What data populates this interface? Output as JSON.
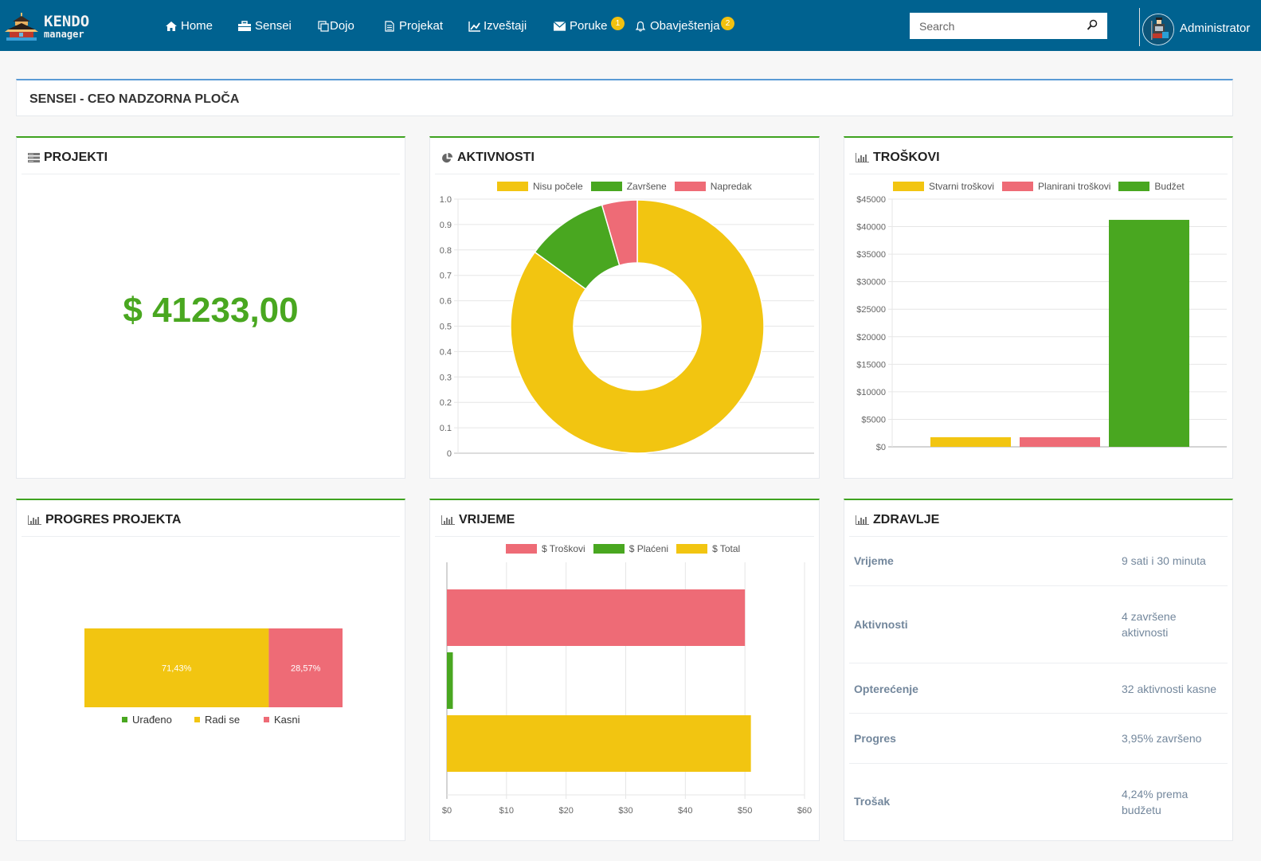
{
  "navbar": {
    "logo_line1": "KENDO",
    "logo_line2": "manager",
    "items": [
      {
        "label": "Home",
        "icon": "home-icon"
      },
      {
        "label": "Sensei",
        "icon": "briefcase-icon"
      },
      {
        "label": "Dojo",
        "icon": "copy-icon"
      },
      {
        "label": "Projekat",
        "icon": "document-icon"
      },
      {
        "label": "Izveštaji",
        "icon": "line-chart-icon"
      },
      {
        "label": "Poruke",
        "icon": "envelope-icon",
        "badge": "1"
      },
      {
        "label": "Obavještenja",
        "icon": "bell-icon",
        "badge": "2"
      }
    ],
    "search_placeholder": "Search",
    "user_name": "Administrator"
  },
  "page": {
    "title": "SENSEI - CEO NADZORNA PLOČA"
  },
  "colors": {
    "navbar": "#006290",
    "green": "#49a720",
    "yellow": "#f2c511",
    "pink": "#ee6b76",
    "blue_accent": "#5b9bd5"
  },
  "panels": {
    "projekti": {
      "title": "PROJEKTI",
      "value": "$ 41233,00"
    },
    "aktivnosti": {
      "title": "AKTIVNOSTI"
    },
    "troskovi": {
      "title": "TROŠKOVI"
    },
    "progres": {
      "title": "PROGRES PROJEKTA"
    },
    "vrijeme": {
      "title": "VRIJEME"
    },
    "zdravlje": {
      "title": "ZDRAVLJE",
      "rows": [
        {
          "label": "Vrijeme",
          "value": "9 sati i 30 minuta"
        },
        {
          "label": "Aktivnosti",
          "value": "4 završene aktivnosti"
        },
        {
          "label": "Opterećenje",
          "value": "32 aktivnosti kasne"
        },
        {
          "label": "Progres",
          "value": "3,95% završeno"
        },
        {
          "label": "Trošak",
          "value": "4,24% prema budžetu"
        }
      ]
    }
  },
  "chart_data": [
    {
      "id": "aktivnosti",
      "type": "pie",
      "title": "AKTIVNOSTI",
      "variant": "doughnut",
      "labels": [
        "Nisu počele",
        "Završene",
        "Napredak"
      ],
      "values": [
        0.85,
        0.105,
        0.045
      ],
      "colors": [
        "#f2c511",
        "#49a720",
        "#ee6b76"
      ],
      "yticks": [
        "0",
        "0.1",
        "0.2",
        "0.3",
        "0.4",
        "0.5",
        "0.6",
        "0.7",
        "0.8",
        "0.9",
        "1.0"
      ],
      "ylim": [
        0,
        1
      ],
      "legend": "top"
    },
    {
      "id": "troskovi",
      "type": "bar",
      "title": "TROŠKOVI",
      "series": [
        {
          "name": "Stvarni troškovi",
          "values": [
            1750
          ],
          "color": "#f2c511"
        },
        {
          "name": "Planirani troškovi",
          "values": [
            1750
          ],
          "color": "#ee6b76"
        },
        {
          "name": "Budžet",
          "values": [
            41233
          ],
          "color": "#49a720"
        }
      ],
      "yticks": [
        "$0",
        "$5000",
        "$10000",
        "$15000",
        "$20000",
        "$25000",
        "$30000",
        "$35000",
        "$40000",
        "$45000"
      ],
      "ylim": [
        0,
        45000
      ],
      "legend": "top"
    },
    {
      "id": "progres",
      "type": "bar",
      "title": "PROGRES PROJEKTA",
      "orientation": "stacked-horizontal",
      "series": [
        {
          "name": "Urađeno",
          "value": 0,
          "label": "",
          "color": "#49a720"
        },
        {
          "name": "Radi se",
          "value": 71.43,
          "label": "71,43%",
          "color": "#f2c511"
        },
        {
          "name": "Kasni",
          "value": 28.57,
          "label": "28,57%",
          "color": "#ee6b76"
        }
      ],
      "legend": "bottom"
    },
    {
      "id": "vrijeme",
      "type": "bar",
      "title": "VRIJEME",
      "orientation": "horizontal",
      "series": [
        {
          "name": "$ Troškovi",
          "values": [
            50
          ],
          "color": "#ee6b76"
        },
        {
          "name": "$ Plaćeni",
          "values": [
            1
          ],
          "color": "#49a720"
        },
        {
          "name": "$ Total",
          "values": [
            51
          ],
          "color": "#f2c511"
        }
      ],
      "xticks": [
        "$0",
        "$10",
        "$20",
        "$30",
        "$40",
        "$50",
        "$60"
      ],
      "xlim": [
        0,
        60
      ],
      "legend": "top"
    }
  ]
}
